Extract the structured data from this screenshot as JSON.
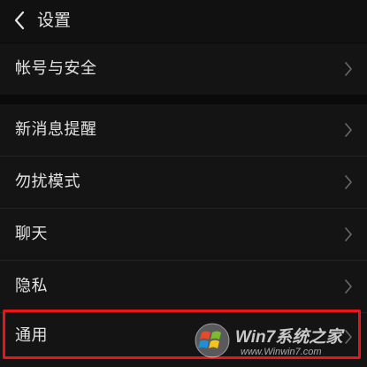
{
  "header": {
    "title": "设置"
  },
  "rows": [
    {
      "label": "帐号与安全"
    },
    {
      "label": "新消息提醒"
    },
    {
      "label": "勿扰模式"
    },
    {
      "label": "聊天"
    },
    {
      "label": "隐私"
    },
    {
      "label": "通用"
    }
  ],
  "watermark": {
    "brand": "Win7系统之家",
    "url": "www.Winwin7.com"
  },
  "colors": {
    "background": "#0f0f0f",
    "row_background": "#141414",
    "highlight": "#e8161a",
    "text": "#e2e2e2"
  },
  "icons": {
    "back": "chevron-left-icon",
    "row_arrow": "chevron-right-icon"
  }
}
